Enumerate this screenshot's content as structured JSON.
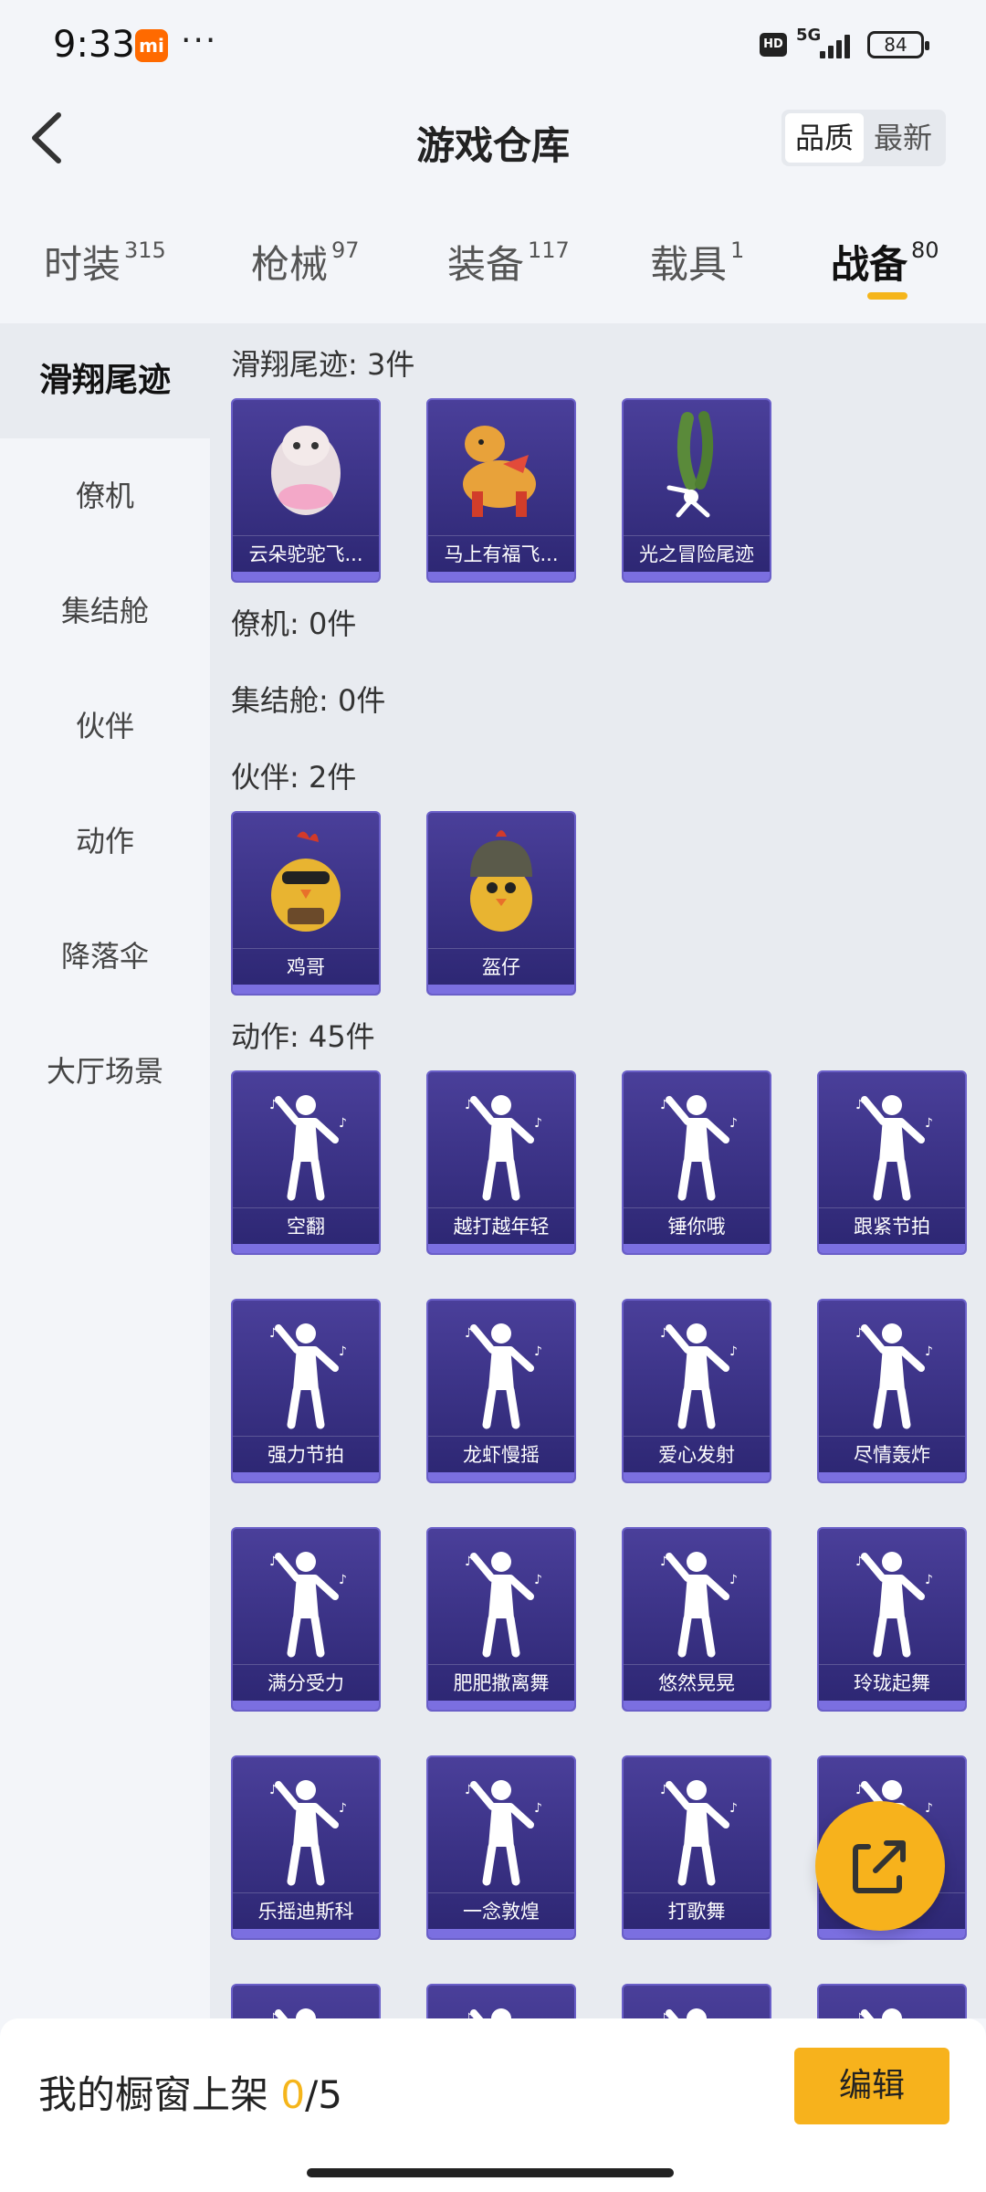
{
  "status_bar": {
    "time": "9:33",
    "mi_badge": "mi",
    "more": "···",
    "hd": "HD",
    "network": "5G",
    "battery": "84"
  },
  "header": {
    "title": "游戏仓库",
    "sort_options": [
      "品质",
      "最新"
    ],
    "sort_selected": "品质"
  },
  "tabs": [
    {
      "label": "时装",
      "count": "315"
    },
    {
      "label": "枪械",
      "count": "97"
    },
    {
      "label": "装备",
      "count": "117"
    },
    {
      "label": "载具",
      "count": "1"
    },
    {
      "label": "战备",
      "count": "80",
      "active": true
    }
  ],
  "sidebar": {
    "items": [
      {
        "label": "滑翔尾迹",
        "active": true
      },
      {
        "label": "僚机"
      },
      {
        "label": "集结舱"
      },
      {
        "label": "伙伴"
      },
      {
        "label": "动作"
      },
      {
        "label": "降落伞"
      },
      {
        "label": "大厅场景"
      }
    ]
  },
  "sections": {
    "glide": {
      "title": "滑翔尾迹: 3件",
      "items": [
        "云朵驼驼飞...",
        "马上有福飞...",
        "光之冒险尾迹"
      ]
    },
    "wingman": {
      "title": "僚机: 0件"
    },
    "pod": {
      "title": "集结舱: 0件"
    },
    "companion": {
      "title": "伙伴: 2件",
      "items": [
        "鸡哥",
        "盔仔"
      ]
    },
    "emote": {
      "title": "动作: 45件",
      "items": [
        "空翻",
        "越打越年轻",
        "锤你哦",
        "跟紧节拍",
        "强力节拍",
        "龙虾慢摇",
        "爱心发射",
        "尽情轰炸",
        "满分受力",
        "肥肥撒离舞",
        "悠然晃晃",
        "玲珑起舞",
        "乐摇迪斯科",
        "一念敦煌",
        "打歌舞",
        ""
      ]
    }
  },
  "bottom": {
    "shelf_label": "我的橱窗上架",
    "shelf_current": "0",
    "shelf_total": "/5",
    "edit_label": "编辑"
  },
  "icons": {
    "back": "chevron-left-icon",
    "share": "share-external-icon"
  },
  "colors": {
    "accent": "#f7b21c",
    "card_bg": "#3a3286",
    "content_bg": "#e8ebf0"
  }
}
